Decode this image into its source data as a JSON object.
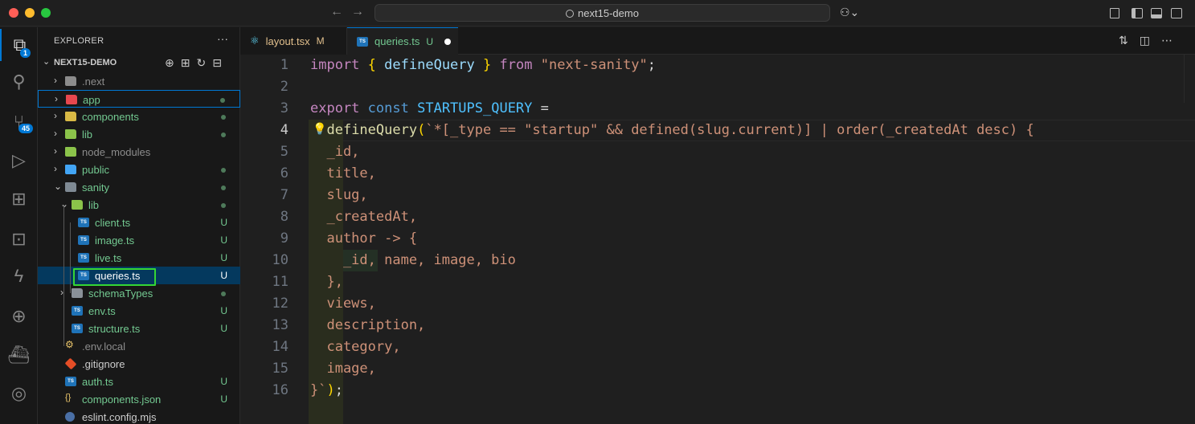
{
  "window": {
    "title": "next15-demo"
  },
  "explorer": {
    "header": "EXPLORER",
    "more": "···",
    "project": "NEXT15-DEMO",
    "items": [
      {
        "name": ".next",
        "type": "folder",
        "color": "#8c8c8c",
        "text_color": "#8c8c8c",
        "status": ""
      },
      {
        "name": "app",
        "type": "folder",
        "color": "#e8474e",
        "text_color": "#73c991",
        "status": "dot"
      },
      {
        "name": "components",
        "type": "folder",
        "color": "#d9b945",
        "text_color": "#73c991",
        "status": "dot"
      },
      {
        "name": "lib",
        "type": "folder",
        "color": "#8bc34a",
        "text_color": "#73c991",
        "status": "dot"
      },
      {
        "name": "node_modules",
        "type": "folder",
        "color": "#8bc34a",
        "text_color": "#8c8c8c",
        "status": ""
      },
      {
        "name": "public",
        "type": "folder",
        "color": "#42a5f5",
        "text_color": "#73c991",
        "status": "dot"
      },
      {
        "name": "sanity",
        "type": "folder",
        "color": "#7f8a94",
        "text_color": "#73c991",
        "status": "dot"
      },
      {
        "name": "lib",
        "type": "folder",
        "color": "#8bc34a",
        "text_color": "#73c991",
        "status": "dot"
      },
      {
        "name": "client.ts",
        "type": "ts",
        "text_color": "#73c991",
        "status": "U"
      },
      {
        "name": "image.ts",
        "type": "ts",
        "text_color": "#73c991",
        "status": "U"
      },
      {
        "name": "live.ts",
        "type": "ts",
        "text_color": "#73c991",
        "status": "U"
      },
      {
        "name": "queries.ts",
        "type": "ts",
        "text_color": "#ffffff",
        "status": "U"
      },
      {
        "name": "schemaTypes",
        "type": "folder",
        "color": "#8a9199",
        "text_color": "#73c991",
        "status": "dot"
      },
      {
        "name": "env.ts",
        "type": "ts",
        "text_color": "#73c991",
        "status": "U"
      },
      {
        "name": "structure.ts",
        "type": "ts",
        "text_color": "#73c991",
        "status": "U"
      },
      {
        "name": ".env.local",
        "type": "env",
        "text_color": "#8c8c8c",
        "status": ""
      },
      {
        "name": ".gitignore",
        "type": "git",
        "text_color": "#cccccc",
        "status": ""
      },
      {
        "name": "auth.ts",
        "type": "ts",
        "text_color": "#73c991",
        "status": "U"
      },
      {
        "name": "components.json",
        "type": "json",
        "text_color": "#73c991",
        "status": "U"
      },
      {
        "name": "eslint.config.mjs",
        "type": "mjs",
        "text_color": "#cccccc",
        "status": ""
      }
    ]
  },
  "activity": {
    "explorer_badge": "1",
    "scm_badge": "45"
  },
  "tabs": [
    {
      "label": "layout.tsx",
      "mark": "M",
      "mark_color": "#e2c08d",
      "label_color": "#e2c08d"
    },
    {
      "label": "queries.ts",
      "mark": "U",
      "mark_color": "#73c991",
      "label_color": "#73c991"
    }
  ],
  "editor": {
    "line_numbers": [
      "1",
      "2",
      "3",
      "4",
      "5",
      "6",
      "7",
      "8",
      "9",
      "10",
      "11",
      "12",
      "13",
      "14",
      "15",
      "16"
    ],
    "current_line": "4"
  },
  "colors": {
    "accent": "#0078d4",
    "highlight_box": "#35d635",
    "git_untracked": "#73c991",
    "git_modified": "#e2c08d"
  }
}
